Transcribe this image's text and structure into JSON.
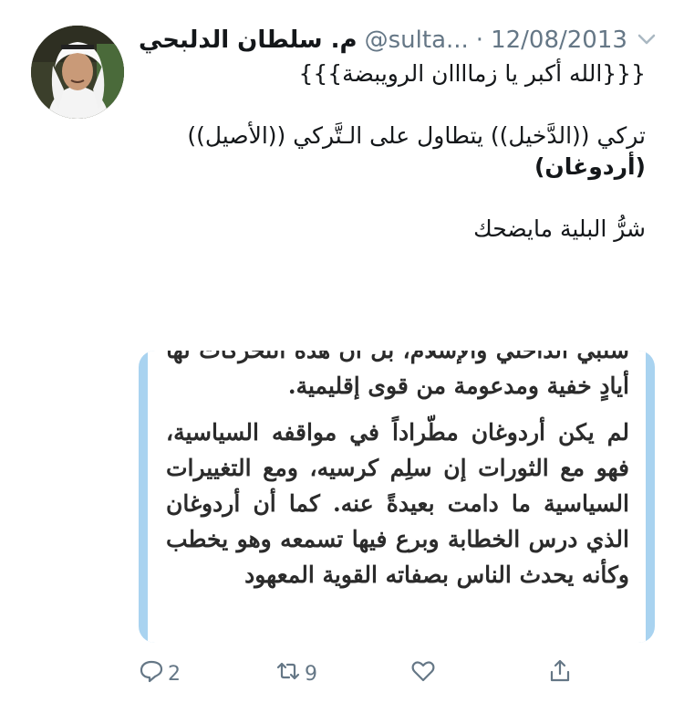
{
  "tweet": {
    "author_name": "م. سلطان الدلبحي",
    "handle": "@sulta...",
    "separator": "·",
    "date": "12/08/2013",
    "text_lines": [
      "{{{الله أكبر يا زماااان الرويبضة}}}",
      "",
      "تركي ((الدَّخيل)) يتطاول على الـتَّركي ((الأصيل))",
      "(أردوغان)",
      "",
      "شرُّ البلية مايضحك"
    ]
  },
  "media": {
    "paragraphs": [
      "سلبي الداخلي والإسلام، بل أن هذه التحركات لها أيادٍ خفية ومدعومة من قوى إقليمية.",
      "لم يكن أردوغان مطّراداً في مواقفه السياسية، فهو مع الثورات إن سلِم كرسيه، ومع التغييرات السياسية ما دامت بعيدةً عنه. كما أن أردوغان الذي درس الخطابة وبرع فيها تسمعه وهو يخطب وكأنه يحدث الناس بصفاته القوية المعهود"
    ],
    "border_color": "#a9d3f0"
  },
  "actions": {
    "reply": {
      "icon": "reply-icon",
      "count": "2"
    },
    "retweet": {
      "icon": "retweet-icon",
      "count": "9"
    },
    "like": {
      "icon": "heart-icon",
      "count": ""
    },
    "share": {
      "icon": "share-icon",
      "count": ""
    }
  },
  "colors": {
    "text": "#14171a",
    "secondary": "#657786"
  }
}
